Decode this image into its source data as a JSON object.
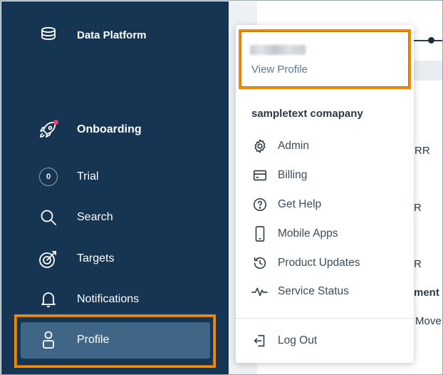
{
  "sidebar": {
    "brand_label": "Data Platform",
    "items": [
      {
        "label": "Onboarding",
        "icon": "rocket-icon"
      },
      {
        "label": "Trial",
        "icon": "trial-counter-icon",
        "counter": "0"
      },
      {
        "label": "Search",
        "icon": "search-icon"
      },
      {
        "label": "Targets",
        "icon": "target-icon"
      },
      {
        "label": "Notifications",
        "icon": "bell-icon"
      },
      {
        "label": "Profile",
        "icon": "user-icon"
      }
    ],
    "active_item": "Profile"
  },
  "dropdown": {
    "view_profile_label": "View Profile",
    "company_name": "sampletext comapany",
    "menu": [
      {
        "label": "Admin",
        "icon": "gear-icon"
      },
      {
        "label": "Billing",
        "icon": "credit-card-icon"
      },
      {
        "label": "Get Help",
        "icon": "help-icon"
      },
      {
        "label": "Mobile Apps",
        "icon": "mobile-phone-icon"
      },
      {
        "label": "Product Updates",
        "icon": "history-icon"
      },
      {
        "label": "Service Status",
        "icon": "pulse-icon"
      }
    ],
    "logout_label": "Log Out"
  },
  "background": {
    "fragments": [
      "RR",
      "R",
      "R",
      "ment",
      "Move"
    ]
  },
  "colors": {
    "sidebar_bg": "#163552",
    "active_item_bg": "#3f6587",
    "highlight": "#f08a00",
    "notification_dot": "#e8436b",
    "link": "#5b7893"
  }
}
